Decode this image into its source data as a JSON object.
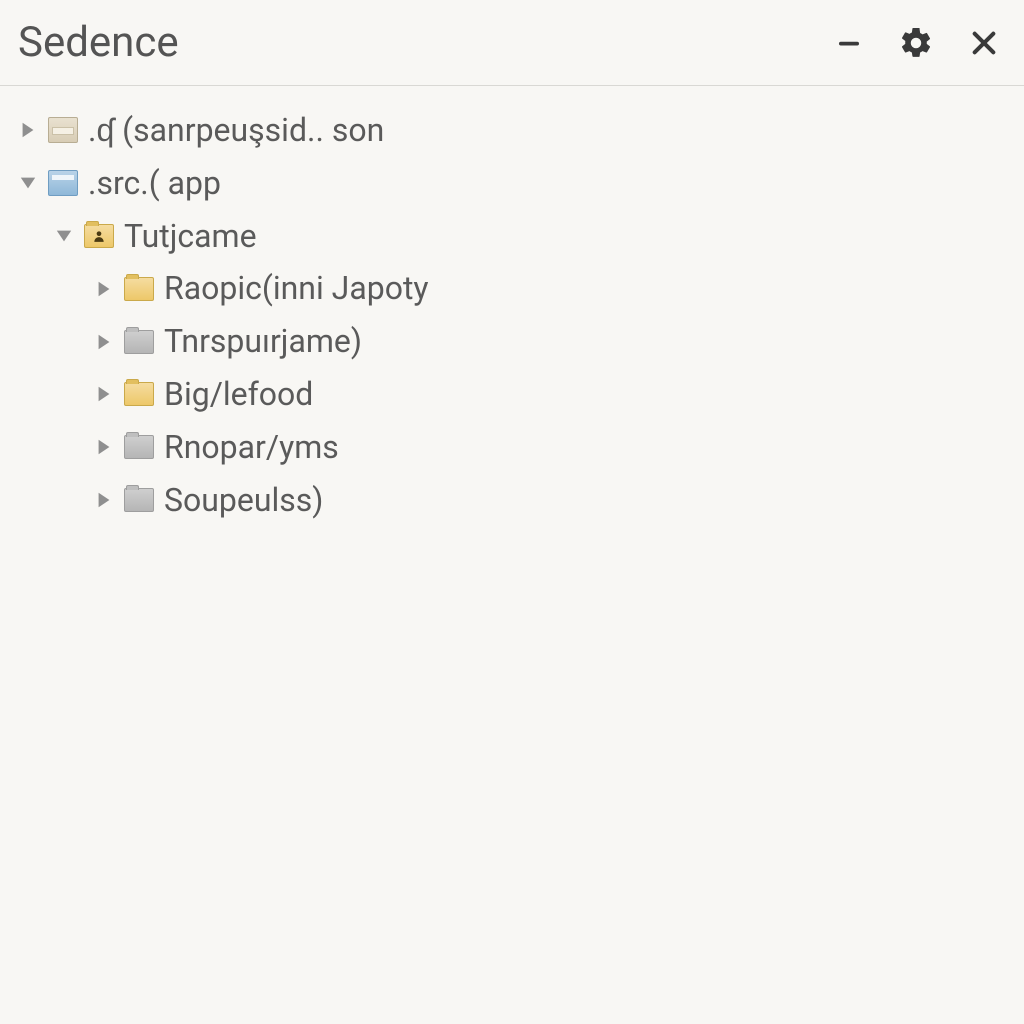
{
  "app": {
    "title": "Sedence"
  },
  "colors": {
    "folder_yellow": "#edc869",
    "folder_gray": "#b5b5b5"
  },
  "tree": {
    "nodes": [
      {
        "label": ".ʠ (sanrpeuşsid.. son",
        "expanded": false,
        "icon": "tan",
        "indent": 0
      },
      {
        "label": ".src.( app",
        "expanded": true,
        "icon": "blue",
        "indent": 0
      },
      {
        "label": "Tutjcame",
        "expanded": true,
        "icon": "user",
        "indent": 1
      },
      {
        "label": "Raopic(inni Japoty",
        "expanded": false,
        "icon": "yellow",
        "indent": 2
      },
      {
        "label": "Tnrspuırjame)",
        "expanded": false,
        "icon": "gray",
        "indent": 2
      },
      {
        "label": "Big/lefood",
        "expanded": false,
        "icon": "yellow",
        "indent": 2
      },
      {
        "label": "Rnopar/yms",
        "expanded": false,
        "icon": "gray",
        "indent": 2
      },
      {
        "label": "Soupeulss)",
        "expanded": false,
        "icon": "gray",
        "indent": 2
      }
    ]
  }
}
